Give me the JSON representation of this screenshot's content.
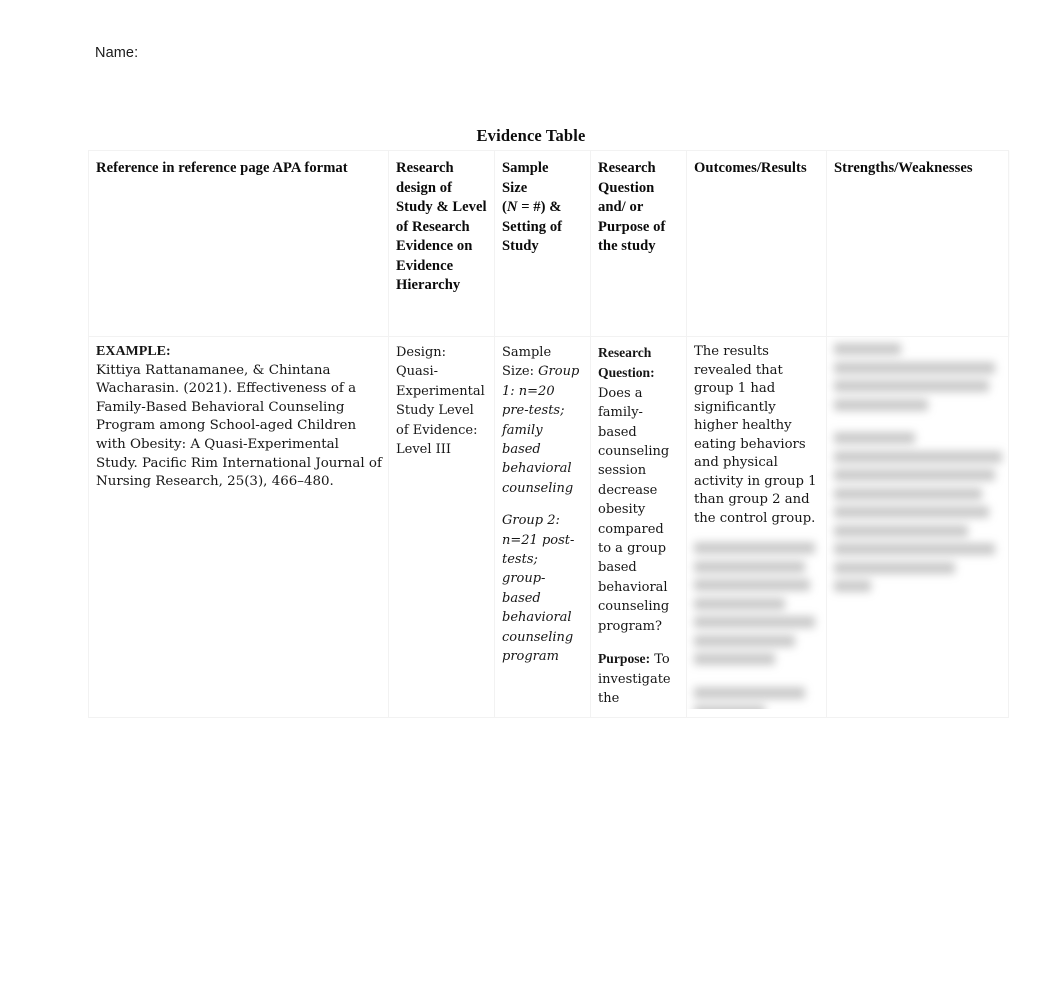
{
  "document": {
    "name_label": "Name:",
    "title": "Evidence Table"
  },
  "table": {
    "headers": [
      "Reference in reference page APA format",
      "Research design of Study & Level of Research Evidence on Evidence Hierarchy",
      "Sample Size",
      "Research Question and/ or Purpose of the study",
      "Outcomes/Results",
      "Strengths/Weaknesses"
    ],
    "header_sample_size_lines": {
      "line1": "Sample",
      "line2": "Size",
      "line3_prefix": "(",
      "line3_italic": "N",
      "line3_suffix": " = #) &",
      "line4": "Setting of",
      "line5": "Study"
    },
    "rows": [
      {
        "reference": {
          "label": "EXAMPLE:",
          "citation": "Kittiya Rattanamanee, & Chintana Wacharasin. (2021). Effectiveness of a Family-Based Behavioral Counseling Program among School-aged Children with Obesity: A Quasi-Experimental Study. Pacific Rim International Journal of Nursing Research, 25(3), 466–480."
        },
        "design": {
          "design_label": "Design:",
          "design_value": "Quasi-Experimental Study",
          "level_label": "Level of Evidence:",
          "level_value": "Level III"
        },
        "sample_size": {
          "heading": "Sample Size:",
          "group1": "Group 1: n=20 pre-tests; family based behavioral counseling",
          "group2": "Group 2: n=21 post-tests; group-based behavioral counseling program"
        },
        "research_question": {
          "question_label": "Research Question:",
          "question_text": "Does a family-based counseling session decrease obesity compared to a group based behavioral counseling program?",
          "purpose_label": "Purpose:",
          "purpose_text": "To investigate the"
        },
        "outcomes": {
          "text": "The results revealed that group 1 had significantly higher healthy eating behaviors and physical activity in group 1 than group 2 and the control group.",
          "redacted_note": "redacted"
        },
        "strengths_weaknesses": {
          "redacted_note": "redacted"
        }
      }
    ]
  }
}
